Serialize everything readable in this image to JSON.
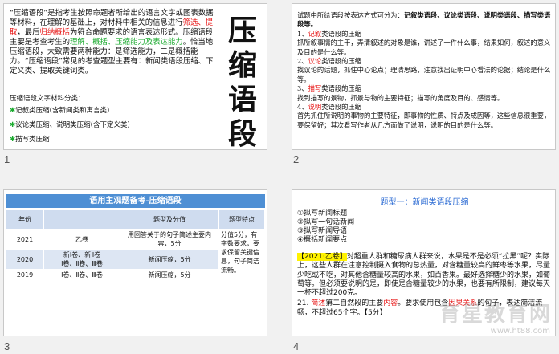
{
  "slides": [
    {
      "number": "1",
      "intro_parts": {
        "p1": "“压缩语段”是指考生按照命题者所给出的语言文字或图表数据等材料，在理解的基础上，对材料中相关的信息进行",
        "red1": "筛选、提取",
        "p2": "，最后",
        "red2": "归纳概括",
        "p3": "为符合命题要求的语言表达形式。压缩语段主要是考查考生的",
        "green1": "理解、概括、压缩能力及表达能力",
        "p4": "。恰当地压缩语段，大致需要两种能力：是筛选能力，二是概括能力。“压缩语段”常见的考查题型主要有：新闻类语段压缩、下定义类、提取关键词类。"
      },
      "big_title": [
        "压",
        "缩",
        "语",
        "段"
      ],
      "subhead": "压缩语段文字材料分类：",
      "items": [
        "记叙类压缩(含新闻类和寓言类)",
        "议论类压缩、说明类压缩(含下定义类)",
        "描写类压缩"
      ]
    },
    {
      "number": "2",
      "lead": "试题中所给语段按表达方式可分为：",
      "lead_bold": "记叙类语段、议论类语段、说明类语段、描写类语段等。",
      "sections": [
        {
          "num": "1、",
          "key": "记叙",
          "rest": "类语段的压缩",
          "body": "抓所叙事情的主干，弄清叙述的对象是谁，讲述了一件什么事，结果如何，叙述的意义及目的是什么等。"
        },
        {
          "num": "2、",
          "key": "议论",
          "rest": "类语段的压缩",
          "body": "找议论的话题，抓住中心论点；理清思路，注意找出证明中心看法的论据；结论是什么等。"
        },
        {
          "num": "3、",
          "key": "描写",
          "rest": "类语段的压缩",
          "body": "找到描写的景物，抓景与物的主要特征；描写的角度及目的、感情等。"
        },
        {
          "num": "4、",
          "key": "说明",
          "rest": "类语段的压缩",
          "body": "首先抓住所说明的事物的主要特征，即事物的性质、特点及成因等，这些信息很重要，要保留好；其次看写作者从几方面做了说明，说明的目的是什么等。"
        }
      ]
    },
    {
      "number": "3",
      "banner": "语用主观题备考-压缩语段",
      "headers": [
        "年份",
        "",
        "题型及分值",
        "题型特点"
      ],
      "rows": [
        {
          "year": "2021",
          "paper": "乙卷",
          "type": "用回答关于的句子简述主要内容，5分",
          "feature": "分值5分，有字数要求，要求保留关键信息，句子简洁流畅。"
        },
        {
          "year": "2020",
          "paper": "新Ⅰ卷、新Ⅱ卷\nⅠ卷、Ⅱ卷、Ⅲ卷",
          "type": "新闻压缩，5分",
          "feature": ""
        },
        {
          "year": "2019",
          "paper": "Ⅰ卷、Ⅱ卷、Ⅲ卷",
          "type": "新闻压缩，5分",
          "feature": ""
        }
      ]
    },
    {
      "number": "4",
      "title": "题型一：新闻类语段压缩",
      "list": [
        "①拟写新闻标题",
        "②拟写一句话新闻",
        "③拟写新闻导语",
        "④概括新闻要点"
      ],
      "q_tag": "【2021·乙卷】",
      "q_text": "对超重人群和糖尿病人群来说，水果是不是必须“拉黑”呢？实际上，这些人群在注意控制摄入食物的总热量，对含糖量较高的鲜枣等水果，尽量少吃或不吃，对其他含糖量较高的水果，如百香果。最好选择糖少的水果，如葡萄等。但必须要说明的是，即使是含糖量较少的水果，也要有所限制，建议每天一杯不超过200克。",
      "q2_prefix": "21. ",
      "q2_red1": "简述",
      "q2_mid": "第二自然段的主要",
      "q2_red2": "内容",
      "q2_mid2": "。要求使用包含",
      "q2_red3": "因果关系",
      "q2_end": "的句子，表达简洁流畅，不超过65个字。【5分】",
      "watermark": "育星教育网",
      "watermark_url": "www.ht88.com"
    }
  ]
}
